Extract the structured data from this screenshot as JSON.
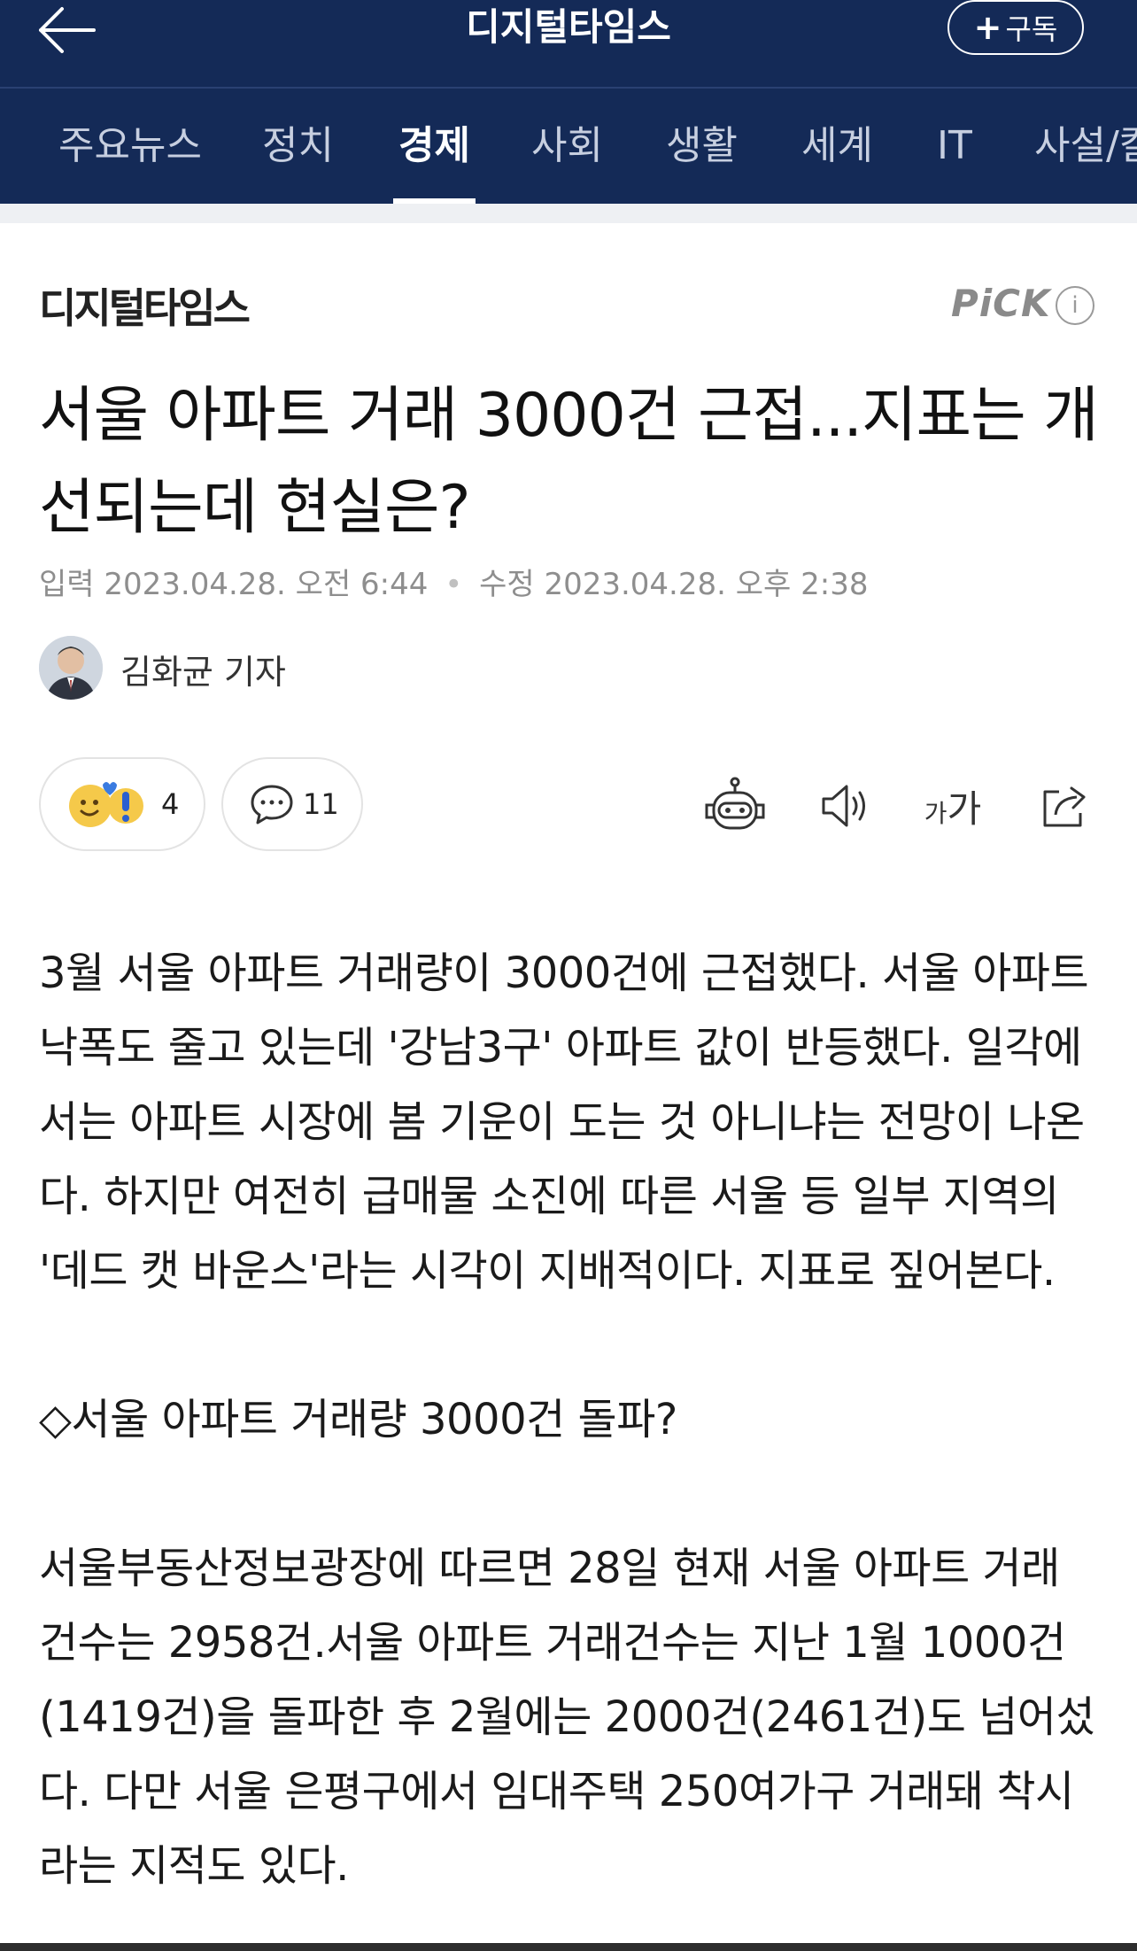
{
  "header": {
    "title": "디지털타임스",
    "subscribe_label": "구독",
    "subscribe_plus": "+"
  },
  "nav": {
    "tabs": [
      "주요뉴스",
      "정치",
      "경제",
      "사회",
      "생활",
      "세계",
      "IT",
      "사설/칼"
    ],
    "active_index": 2
  },
  "article": {
    "press_name": "디지털타임스",
    "pick_label": "PiCK",
    "info_glyph": "i",
    "headline": "서울 아파트 거래 3000건 근접...지표는 개선되는데 현실은?",
    "input_label": "입력",
    "input_date": "2023.04.28. 오전 6:44",
    "edit_label": "수정",
    "edit_date": "2023.04.28. 오후 2:38",
    "reporter": "김화균 기자",
    "reaction_count": "4",
    "comment_count": "11",
    "font_tool_small": "가",
    "font_tool_large": "가",
    "paragraphs": [
      "3월 서울 아파트 거래량이 3000건에 근접했다. 서울 아파트 낙폭도 줄고 있는데 '강남3구' 아파트 값이 반등했다. 일각에서는 아파트 시장에 봄 기운이 도는 것 아니냐는 전망이 나온다. 하지만 여전히 급매물 소진에 따른 서울 등 일부 지역의 '데드 캣 바운스'라는 시각이 지배적이다. 지표로 짚어본다.",
      "◇서울 아파트 거래량 3000건 돌파?",
      "서울부동산정보광장에 따르면 28일 현재 서울 아파트 거래 건수는 2958건.서울 아파트 거래건수는 지난 1월 1000건(1419건)을 돌파한 후 2월에는 2000건(2461건)도 넘어섰다. 다만 서울 은평구에서 임대주택 250여가구 거래돼 착시라는 지적도 있다."
    ]
  },
  "colors": {
    "header_bg": "#142a57",
    "active_tab": "#ffffff",
    "muted_text": "#8e8e8e"
  }
}
